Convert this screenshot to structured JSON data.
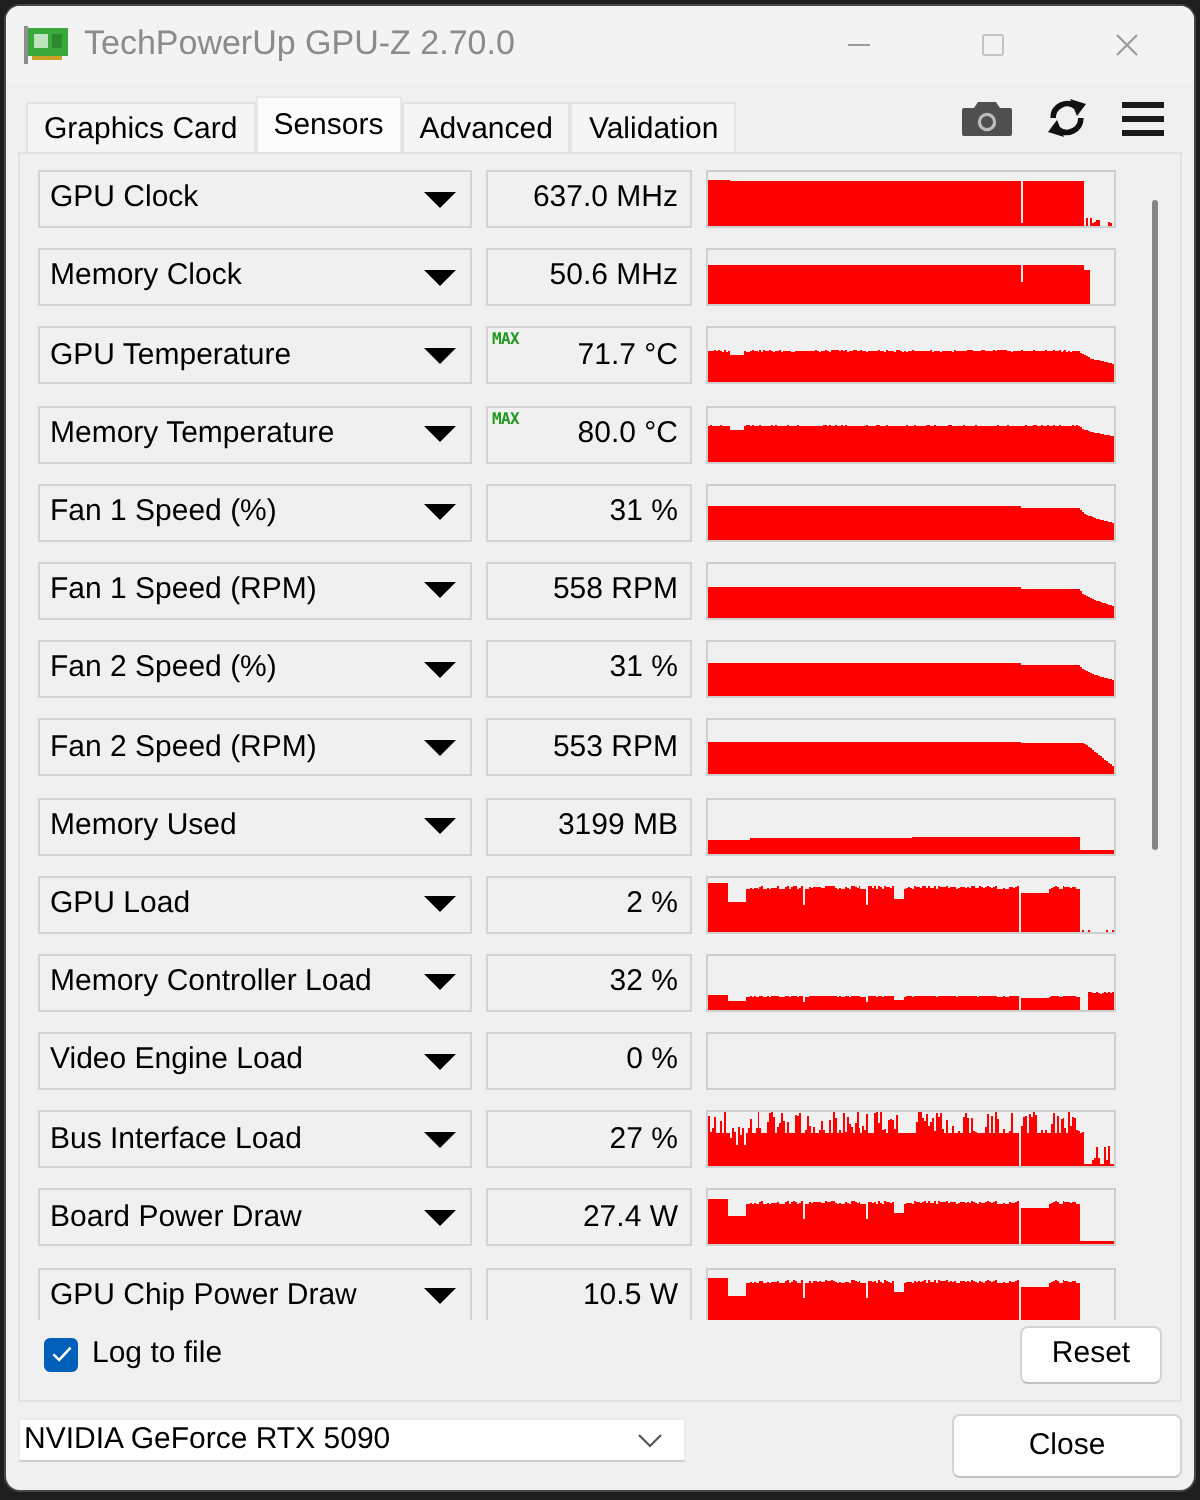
{
  "window": {
    "title": "TechPowerUp GPU-Z 2.70.0"
  },
  "tabs": [
    {
      "label": "Graphics Card",
      "selected": false
    },
    {
      "label": "Sensors",
      "selected": true
    },
    {
      "label": "Advanced",
      "selected": false
    },
    {
      "label": "Validation",
      "selected": false
    }
  ],
  "sensors": [
    {
      "name": "GPU Clock",
      "value": "637.0 MHz"
    },
    {
      "name": "Memory Clock",
      "value": "50.6 MHz"
    },
    {
      "name": "GPU Temperature",
      "indicator": "MAX",
      "value": "71.7 °C"
    },
    {
      "name": "Memory Temperature",
      "indicator": "MAX",
      "value": "80.0 °C"
    },
    {
      "name": "Fan 1 Speed (%)",
      "value": "31 %"
    },
    {
      "name": "Fan 1 Speed (RPM)",
      "value": "558 RPM"
    },
    {
      "name": "Fan 2 Speed (%)",
      "value": "31 %"
    },
    {
      "name": "Fan 2 Speed (RPM)",
      "value": "553 RPM"
    },
    {
      "name": "Memory Used",
      "value": "3199 MB"
    },
    {
      "name": "GPU Load",
      "value": "2 %"
    },
    {
      "name": "Memory Controller Load",
      "value": "32 %"
    },
    {
      "name": "Video Engine Load",
      "value": "0 %"
    },
    {
      "name": "Bus Interface Load",
      "value": "27 %"
    },
    {
      "name": "Board Power Draw",
      "value": "27.4 W"
    },
    {
      "name": "GPU Chip Power Draw",
      "value": "10.5 W"
    }
  ],
  "log_to_file": {
    "label": "Log to file",
    "checked": true
  },
  "reset_button": {
    "label": "Reset"
  },
  "gpu_select": {
    "value": "NVIDIA GeForce RTX 5090"
  },
  "close_button": {
    "label": "Close"
  }
}
